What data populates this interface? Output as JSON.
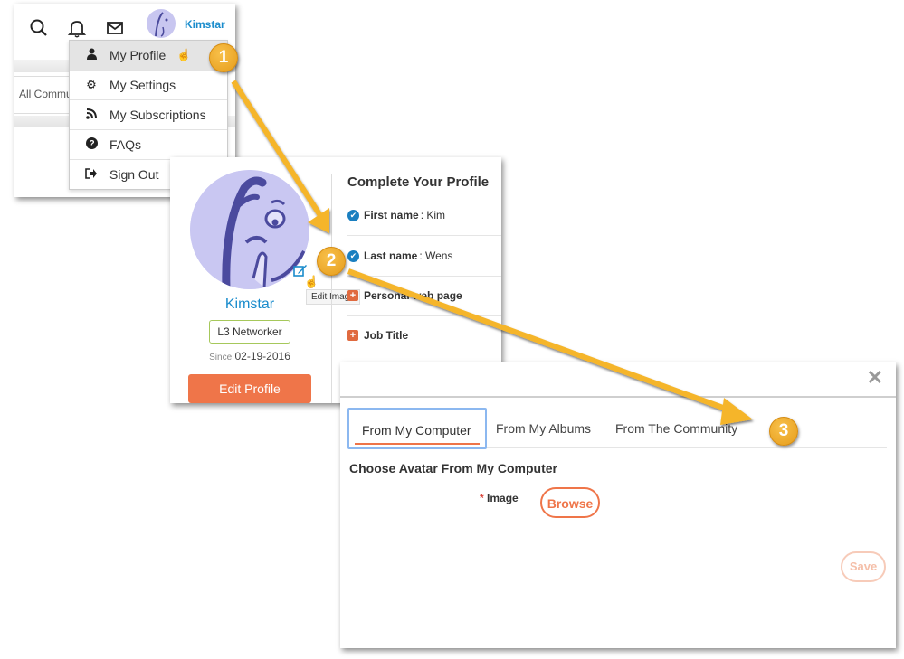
{
  "panel_menu": {
    "username": "Kimstar",
    "topbar_icons": [
      "search-icon",
      "bell-icon",
      "mail-icon"
    ],
    "background_text": "All Commu",
    "menu_items": [
      {
        "label": "My Profile",
        "icon": "user-icon",
        "active": true
      },
      {
        "label": "My Settings",
        "icon": "gear-icon",
        "active": false
      },
      {
        "label": "My Subscriptions",
        "icon": "rss-icon",
        "active": false
      },
      {
        "label": "FAQs",
        "icon": "question-icon",
        "active": false
      },
      {
        "label": "Sign Out",
        "icon": "sign-out-icon",
        "active": false
      }
    ]
  },
  "panel_profile": {
    "username": "Kimstar",
    "rank": "L3 Networker",
    "since_label": "Since",
    "since_date": "02-19-2016",
    "edit_profile_label": "Edit Profile",
    "edit_image_tooltip": "Edit Image",
    "complete_title": "Complete Your Profile",
    "fields": [
      {
        "label": "First name",
        "value": ": Kim",
        "status": "complete"
      },
      {
        "label": "Last name",
        "value": ": Wens",
        "status": "complete"
      },
      {
        "label": "Personal web page",
        "value": "",
        "status": "incomplete"
      },
      {
        "label": "Job Title",
        "value": "",
        "status": "incomplete"
      }
    ]
  },
  "panel_avatar": {
    "close_label": "✕",
    "tabs": [
      {
        "label": "From My Computer",
        "active": true
      },
      {
        "label": "From My Albums",
        "active": false
      },
      {
        "label": "From The Community",
        "active": false
      }
    ],
    "section_title": "Choose Avatar From My Computer",
    "required_mark": "*",
    "image_label": "Image",
    "browse_label": "Browse",
    "save_label": "Save"
  },
  "callouts": [
    "1",
    "2",
    "3"
  ],
  "colors": {
    "accent_orange": "#ef7549",
    "link_blue": "#1a8ccc",
    "callout_gold": "#f0ad2e",
    "arrow_gold": "#f5b52a"
  }
}
